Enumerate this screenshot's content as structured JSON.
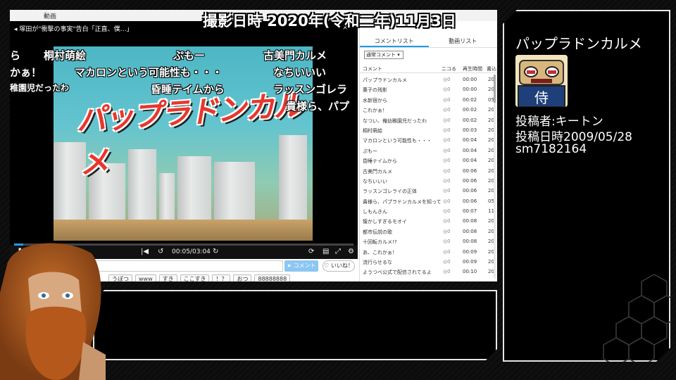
{
  "overlay": {
    "capture_date": "撮影日時 2020年(令和二年)11月3日"
  },
  "browser": {
    "top_tab": "動画"
  },
  "player": {
    "title": "塚田が\"衝撃の事実\"告白「正直、僕…」",
    "close_icon": "×",
    "time_display": "00:05/03:04",
    "progress_fraction": 0.027,
    "video_logo_text": "パップラドンカルメ",
    "danmaku": [
      {
        "text": "桐村萌絵"
      },
      {
        "text": "ぷもー"
      },
      {
        "text": "古美門カルメ"
      },
      {
        "text": "マカロンという可能性も・・・"
      },
      {
        "text": "なちいいい"
      },
      {
        "text": "かぁ！"
      },
      {
        "text": "昏睡テイムから"
      },
      {
        "text": "ラッスンゴレラ"
      },
      {
        "text": "稚園児だったわ"
      },
      {
        "text": "貴様ら、パプ"
      },
      {
        "text": "ら"
      }
    ]
  },
  "comment_form": {
    "submit_label": "コメント",
    "like_label": "いいね！",
    "chips": [
      "うぽつ",
      "www",
      "すき",
      "ここすき",
      "！？",
      "おつ",
      "88888888"
    ]
  },
  "comment_panel": {
    "tabs": [
      "コメントリスト",
      "動画リスト"
    ],
    "sort_select": "通常コメント",
    "headers": {
      "comment": "コメント",
      "nicoru": "ニコる",
      "time": "再生時間",
      "date": "書込"
    },
    "rows": [
      {
        "c": "パップラドンカルメ",
        "t": "00:00",
        "d": "20"
      },
      {
        "c": "菓子の残影",
        "t": "00:00",
        "d": "20"
      },
      {
        "c": "水新宿から",
        "t": "00:02",
        "d": "05"
      },
      {
        "c": "これかぁ！",
        "t": "00:02",
        "d": "20"
      },
      {
        "c": "なつい、俺幼稚園児だったわ",
        "t": "00:02",
        "d": "20"
      },
      {
        "c": "桐村萌絵",
        "t": "00:03",
        "d": "20"
      },
      {
        "c": "マカロンという可能性も・・・",
        "t": "00:04",
        "d": "20"
      },
      {
        "c": "ぷもー",
        "t": "00:04",
        "d": "20"
      },
      {
        "c": "昏睡テイムから",
        "t": "00:04",
        "d": "20"
      },
      {
        "c": "古美門カルメ",
        "t": "00:06",
        "d": "20"
      },
      {
        "c": "なちいいい",
        "t": "00:06",
        "d": "20"
      },
      {
        "c": "ラッスンゴレライの正体",
        "t": "00:06",
        "d": "20"
      },
      {
        "c": "貴様ら、パプラドンカルメを知って…",
        "t": "00:06",
        "d": "05"
      },
      {
        "c": "しもんきん",
        "t": "00:07",
        "d": "11"
      },
      {
        "c": "懐かしすぎるモオイ",
        "t": "00:08",
        "d": "20"
      },
      {
        "c": "都市伝説の歌",
        "t": "00:08",
        "d": "20"
      },
      {
        "c": "十回転カルメ!?",
        "t": "00:08",
        "d": "20"
      },
      {
        "c": "あ、これかぁ！",
        "t": "00:09",
        "d": "20"
      },
      {
        "c": "流行らせるな",
        "t": "00:09",
        "d": "20"
      },
      {
        "c": "ようつべ公式で配信されてるよ",
        "t": "00:10",
        "d": "20"
      }
    ]
  },
  "info": {
    "title": "パップラドンカルメ",
    "uploader": "投稿者:キートン",
    "upload_date": "投稿日時2009/05/28",
    "video_id": "sm7182164",
    "thumb_text": "侍"
  },
  "colors": {
    "accent": "#1a9cf0",
    "logo_red": "#e8372d",
    "frame": "#e6e6e6"
  }
}
